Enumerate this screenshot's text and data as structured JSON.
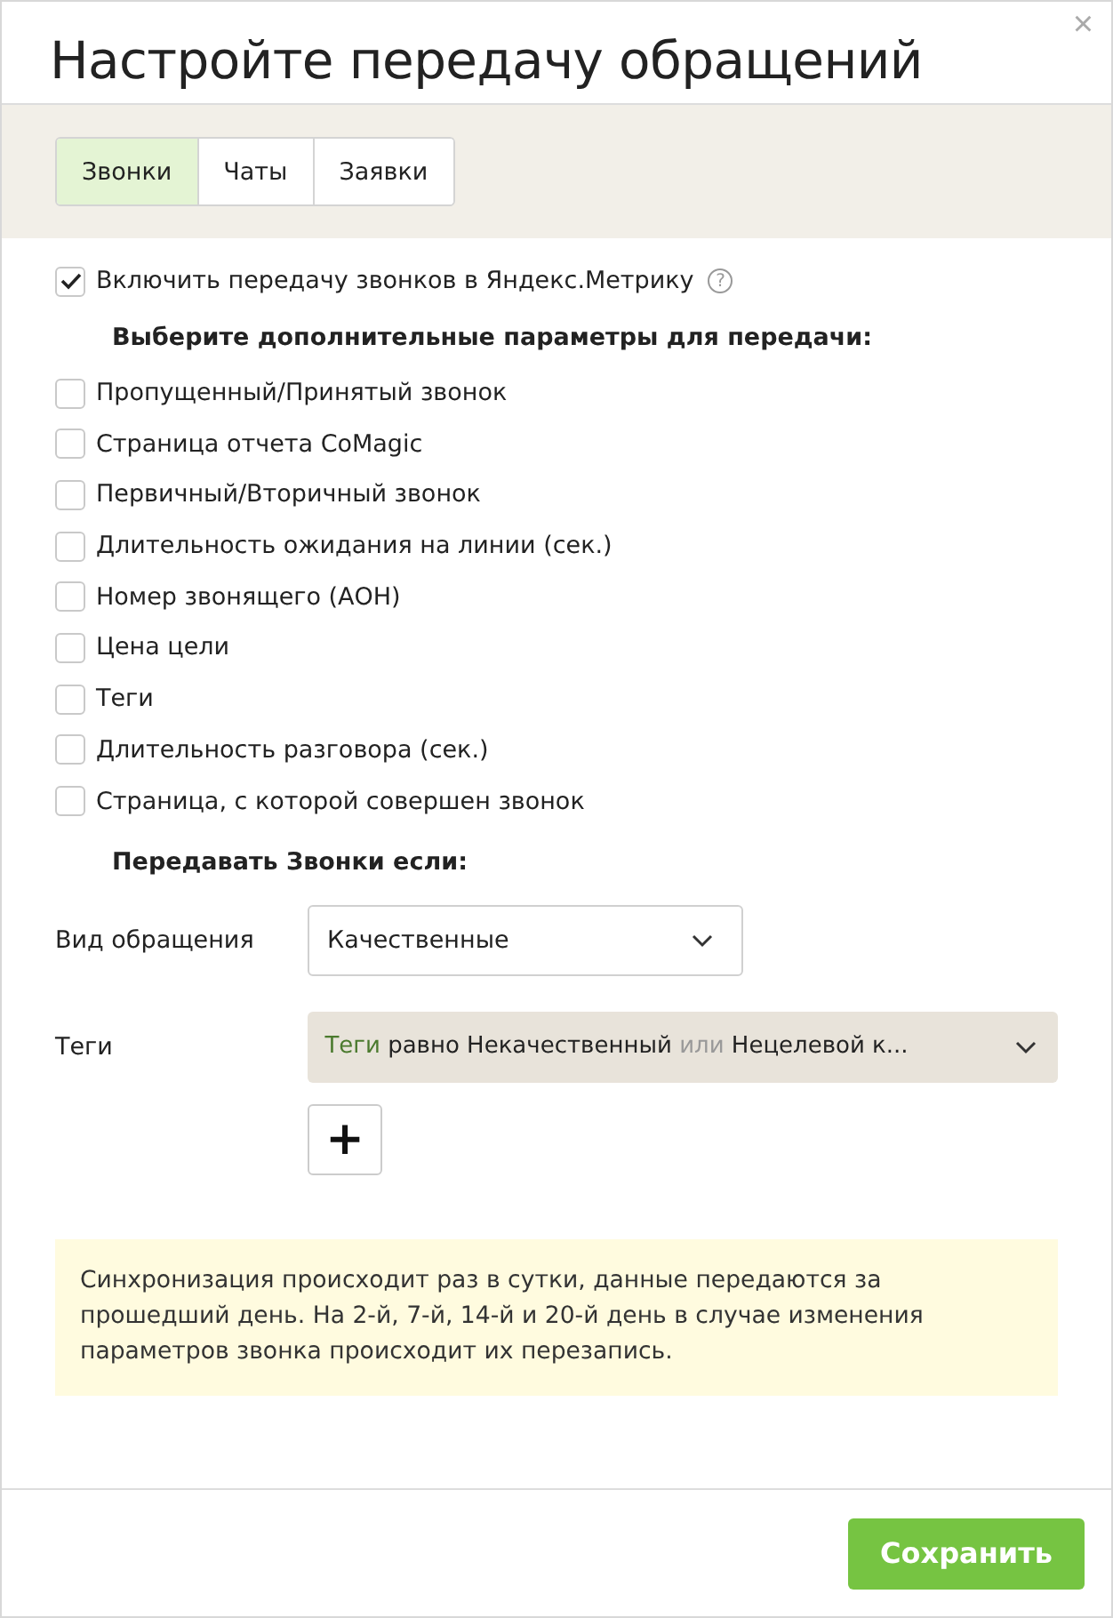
{
  "dialog": {
    "title": "Настройте передачу обращений",
    "close": "×"
  },
  "tabs": [
    {
      "label": "Звонки",
      "selected": true
    },
    {
      "label": "Чаты",
      "selected": false
    },
    {
      "label": "Заявки",
      "selected": false
    }
  ],
  "main_option": {
    "label": "Включить передачу звонков в Яндекс.Метрику",
    "checked": true,
    "help": "?"
  },
  "params_heading": "Выберите дополнительные параметры для передачи:",
  "params": [
    {
      "label": "Пропущенный/Принятый звонок",
      "checked": false
    },
    {
      "label": "Страница отчета CoMagic",
      "checked": false
    },
    {
      "label": "Первичный/Вторичный звонок",
      "checked": false
    },
    {
      "label": "Длительность ожидания на линии (сек.)",
      "checked": false
    },
    {
      "label": "Номер звонящего (АОН)",
      "checked": false
    },
    {
      "label": "Цена цели",
      "checked": false
    },
    {
      "label": "Теги",
      "checked": false
    },
    {
      "label": "Длительность разговора (сек.)",
      "checked": false
    },
    {
      "label": "Страница, с которой совершен звонок",
      "checked": false
    }
  ],
  "conditions_heading": "Передавать Звонки если:",
  "request_type": {
    "label": "Вид обращения",
    "value": "Качественные"
  },
  "tags_filter": {
    "label": "Теги",
    "parts": [
      {
        "kind": "field",
        "text": "Теги"
      },
      {
        "kind": "value",
        "text": "равно Некачественный"
      },
      {
        "kind": "operator",
        "text": "или"
      },
      {
        "kind": "value",
        "text": "Нецелевой к..."
      }
    ],
    "add": "+"
  },
  "note": "Синхронизация происходит раз в сутки, данные передаются за прошедший день. На 2-й, 7-й, 14-й и 20-й день в случае изменения параметров звонка происходит их перезапись.",
  "save_button": "Сохранить"
}
